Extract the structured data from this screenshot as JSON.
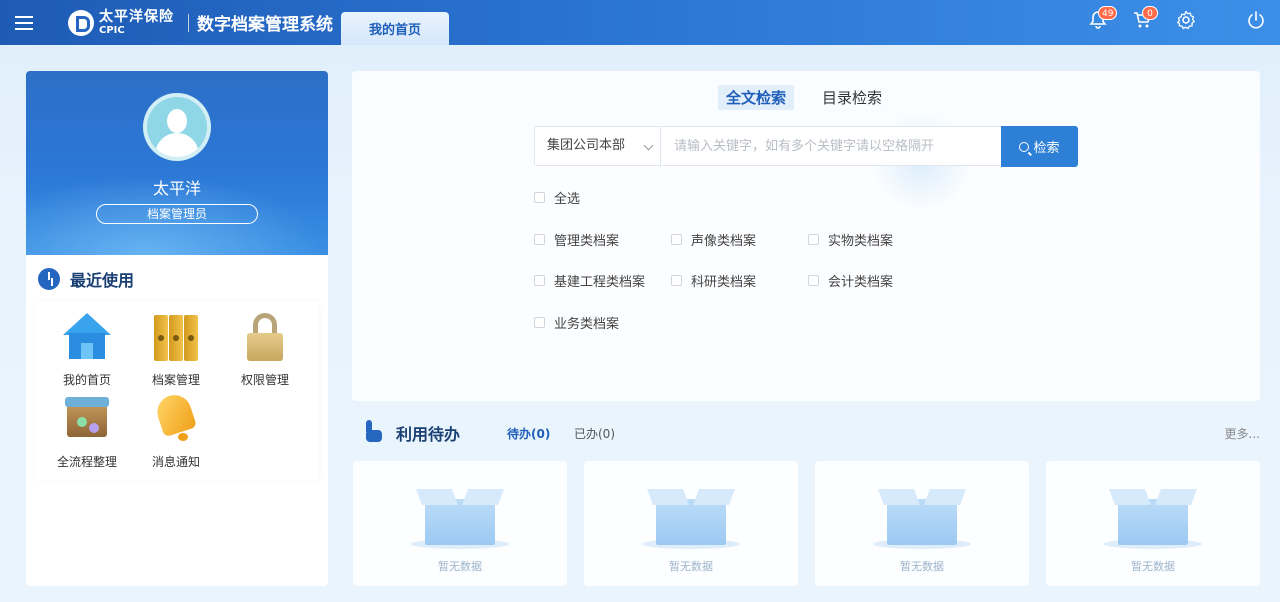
{
  "header": {
    "brand_cn": "太平洋保险",
    "brand_en": "CPIC",
    "app_title": "数字档案管理系统",
    "home_tab": "我的首页",
    "notifications_count": "49",
    "cart_count": "0"
  },
  "profile": {
    "name": "太平洋",
    "role": "档案管理员"
  },
  "recent": {
    "title": "最近使用",
    "items": [
      {
        "label": "我的首页",
        "icon": "house-icon"
      },
      {
        "label": "档案管理",
        "icon": "binder-icon"
      },
      {
        "label": "权限管理",
        "icon": "lock-icon"
      },
      {
        "label": "全流程整理",
        "icon": "workflow-box-icon"
      },
      {
        "label": "消息通知",
        "icon": "bell-icon"
      }
    ]
  },
  "search": {
    "tabs": [
      {
        "label": "全文检索",
        "active": true
      },
      {
        "label": "目录检索",
        "active": false
      }
    ],
    "scope": "集团公司本部",
    "placeholder": "请输入关键字，如有多个关键字请以空格隔开",
    "button": "检索",
    "select_all": "全选",
    "categories": [
      "管理类档案",
      "声像类档案",
      "实物类档案",
      "基建工程类档案",
      "科研类档案",
      "会计类档案",
      "业务类档案"
    ]
  },
  "todo": {
    "title": "利用待办",
    "tabs": [
      {
        "label": "待办(0)",
        "active": true
      },
      {
        "label": "已办(0)",
        "active": false
      }
    ],
    "more": "更多...",
    "cards": [
      {
        "empty_text": "暂无数据"
      },
      {
        "empty_text": "暂无数据"
      },
      {
        "empty_text": "暂无数据"
      },
      {
        "empty_text": "暂无数据"
      }
    ]
  }
}
